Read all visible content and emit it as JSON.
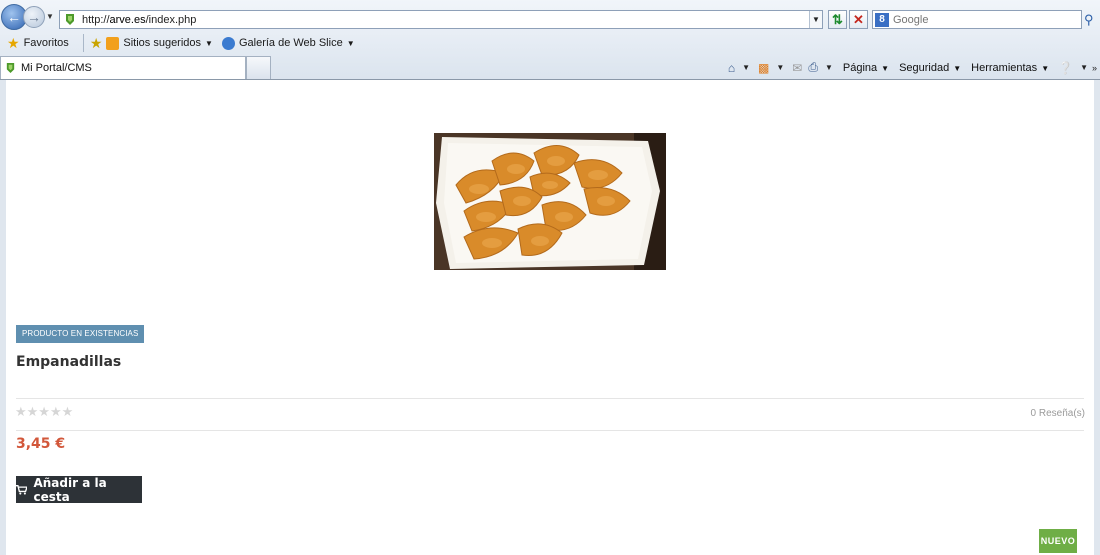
{
  "browser": {
    "address_url_prefix": "http://",
    "address_url_host": "arve.es",
    "address_url_path": "/index.php",
    "search_placeholder": "Google",
    "favorites_label": "Favoritos",
    "suggested_sites_label": "Sitios sugeridos",
    "web_slice_label": "Galería de Web Slice",
    "tab_title": "Mi Portal/CMS",
    "menu_page": "Página",
    "menu_security": "Seguridad",
    "menu_tools": "Herramientas"
  },
  "product": {
    "stock_badge": "Producto en existencias",
    "name": "Empanadillas",
    "rating_stars": "★★★★★",
    "rating_value": 0,
    "reviews_text": "0 Reseña(s)",
    "price": "3,45 €",
    "add_to_cart_label": "Añadir a la cesta",
    "new_badge": "NUEVO"
  },
  "colors": {
    "stock_badge": "#5f8fb0",
    "price": "#d2573a",
    "cart_button": "#2d3237",
    "new_badge": "#6fae46"
  },
  "icons": {
    "back": "back-arrow-icon",
    "forward": "forward-arrow-icon",
    "refresh": "refresh-icon",
    "stop": "stop-icon",
    "search": "search-icon",
    "home": "home-icon",
    "feeds": "rss-icon",
    "mail": "mail-icon",
    "print": "print-icon",
    "help": "help-icon",
    "cart": "cart-icon"
  }
}
